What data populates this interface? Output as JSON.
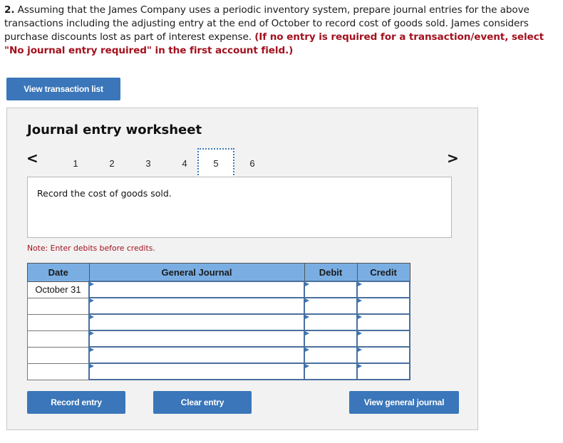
{
  "question": {
    "number": "2.",
    "text": " Assuming that the James Company uses a periodic inventory system, prepare journal entries for the above transactions including the adjusting entry at the end of October to record cost of goods sold. James considers purchase discounts lost as part of interest expense. ",
    "instruction": "(If no entry is required for a transaction/event, select \"No journal entry required\" in the first account field.)"
  },
  "buttons": {
    "view_transaction_list": "View transaction list",
    "record_entry": "Record entry",
    "clear_entry": "Clear entry",
    "view_general_journal": "View general journal"
  },
  "worksheet": {
    "title": "Journal entry worksheet",
    "prev_icon": "chevron-left-icon",
    "next_icon": "chevron-right-icon",
    "prev_glyph": "<",
    "next_glyph": ">",
    "tabs": [
      {
        "label": "1",
        "active": false
      },
      {
        "label": "2",
        "active": false
      },
      {
        "label": "3",
        "active": false
      },
      {
        "label": "4",
        "active": false
      },
      {
        "label": "5",
        "active": true
      },
      {
        "label": "6",
        "active": false
      }
    ],
    "description": "Record the cost of goods sold.",
    "note": "Note: Enter debits before credits."
  },
  "table": {
    "headers": {
      "date": "Date",
      "account": "General Journal",
      "debit": "Debit",
      "credit": "Credit"
    },
    "rows": [
      {
        "date": "October 31",
        "account": "",
        "debit": "",
        "credit": ""
      },
      {
        "date": "",
        "account": "",
        "debit": "",
        "credit": ""
      },
      {
        "date": "",
        "account": "",
        "debit": "",
        "credit": ""
      },
      {
        "date": "",
        "account": "",
        "debit": "",
        "credit": ""
      },
      {
        "date": "",
        "account": "",
        "debit": "",
        "credit": ""
      },
      {
        "date": "",
        "account": "",
        "debit": "",
        "credit": ""
      }
    ]
  },
  "colors": {
    "button_bg": "#3a76b9",
    "instruction_red": "#a3111e",
    "header_blue": "#7aaee3",
    "panel_bg": "#f2f2f2"
  }
}
